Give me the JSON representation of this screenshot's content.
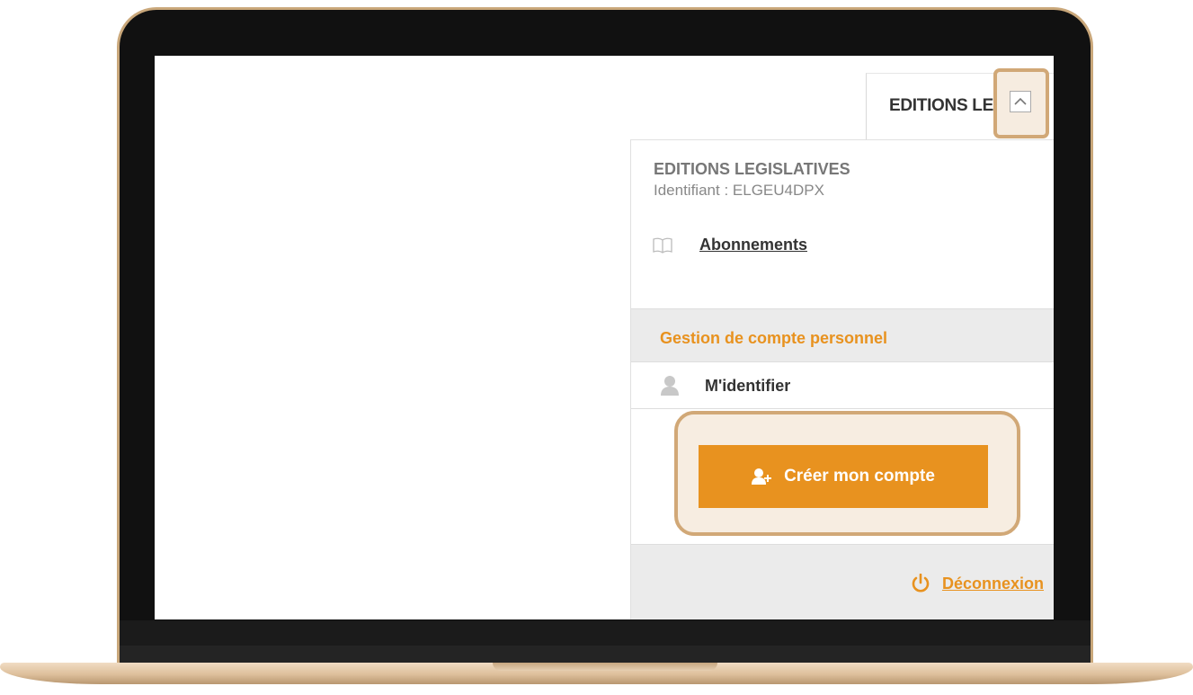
{
  "tab": {
    "title": "EDITIONS LEGI",
    "ellipsis": ".."
  },
  "account": {
    "name": "EDITIONS LEGISLATIVES",
    "id_label": "Identifiant :",
    "id_value": "ELGEU4DPX",
    "subscriptions_label": "Abonnements"
  },
  "personal": {
    "section_title": "Gestion de compte personnel",
    "identify_label": "M'identifier",
    "create_label": "Créer mon compte"
  },
  "footer": {
    "logout_label": "Déconnexion"
  },
  "colors": {
    "accent": "#e8921f",
    "highlight_border": "#d1a877",
    "panel_gray": "#ebebeb"
  },
  "icons": {
    "chevron": "chevron-up-icon",
    "book": "book-icon",
    "user": "user-icon",
    "add_user": "add-user-icon",
    "power": "power-icon"
  }
}
